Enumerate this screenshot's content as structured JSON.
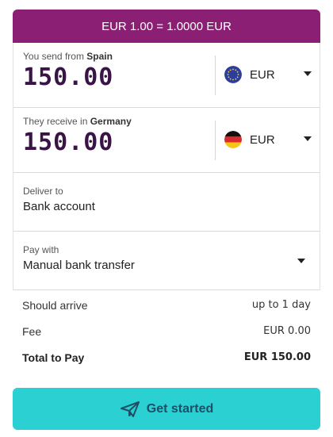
{
  "rate_banner": "EUR 1.00 = 1.0000 EUR",
  "send": {
    "label_prefix": "You send from",
    "country": "Spain",
    "amount": "150.00",
    "currency": "EUR",
    "flag_icon": "eu-flag-icon"
  },
  "receive": {
    "label_prefix": "They receive in",
    "country": "Germany",
    "amount": "150.00",
    "currency": "EUR",
    "flag_icon": "germany-flag-icon"
  },
  "deliver": {
    "label": "Deliver to",
    "value": "Bank account"
  },
  "pay": {
    "label": "Pay with",
    "value": "Manual bank transfer"
  },
  "summary": {
    "arrive_label": "Should arrive",
    "arrive_value": "up to 1 day",
    "fee_label": "Fee",
    "fee_value": "EUR 0.00",
    "total_label": "Total to Pay",
    "total_value": "EUR 150.00"
  },
  "cta": {
    "label": "Get started",
    "icon": "paper-plane-icon"
  },
  "colors": {
    "banner": "#8b1f73",
    "amount_text": "#3a1446",
    "cta_background": "#2bd0d2",
    "cta_text": "#1d4f66"
  }
}
